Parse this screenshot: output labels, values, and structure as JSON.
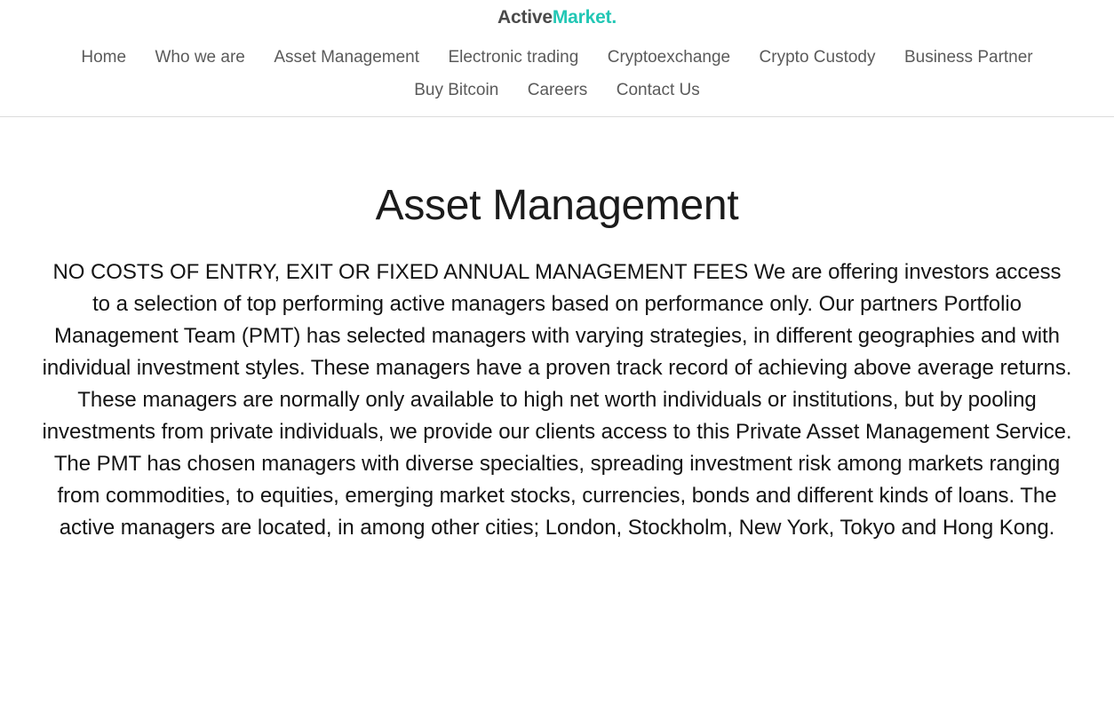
{
  "site": {
    "brand": {
      "part_one": "Active",
      "part_two": "Market.",
      "color_part_one": "#4a4a4a",
      "color_part_two": "#22c7b5"
    }
  },
  "nav": {
    "items": [
      {
        "label": "Home"
      },
      {
        "label": "Who we are"
      },
      {
        "label": "Asset Management"
      },
      {
        "label": "Electronic trading"
      },
      {
        "label": "Cryptoexchange"
      },
      {
        "label": "Crypto Custody"
      },
      {
        "label": "Business Partner"
      },
      {
        "label": "Buy Bitcoin"
      },
      {
        "label": "Careers"
      },
      {
        "label": "Contact Us"
      }
    ]
  },
  "main": {
    "title": "Asset Management",
    "body": "NO COSTS OF ENTRY, EXIT OR FIXED ANNUAL MANAGEMENT FEES We are offering investors access to a selection of top performing active managers based on performance only. Our partners Portfolio Management Team (PMT) has selected managers with varying strategies, in different geographies and with individual investment styles. These managers have a proven track record of achieving above average returns. These managers are normally only available to high net worth individuals or institutions, but by pooling investments from private individuals, we provide our clients access to this Private Asset Management Service.  The PMT has chosen managers with diverse specialties, spreading investment risk among markets ranging from commodities, to equities, emerging market stocks, currencies, bonds and different kinds of loans. The active managers are located, in among other cities; London, Stockholm, New York, Tokyo and Hong Kong."
  },
  "theme": {
    "background": "#ffffff",
    "text": "#141414",
    "nav_text": "#5a5a5a",
    "accent": "#22c7b5",
    "divider": "#dcdcdc"
  }
}
